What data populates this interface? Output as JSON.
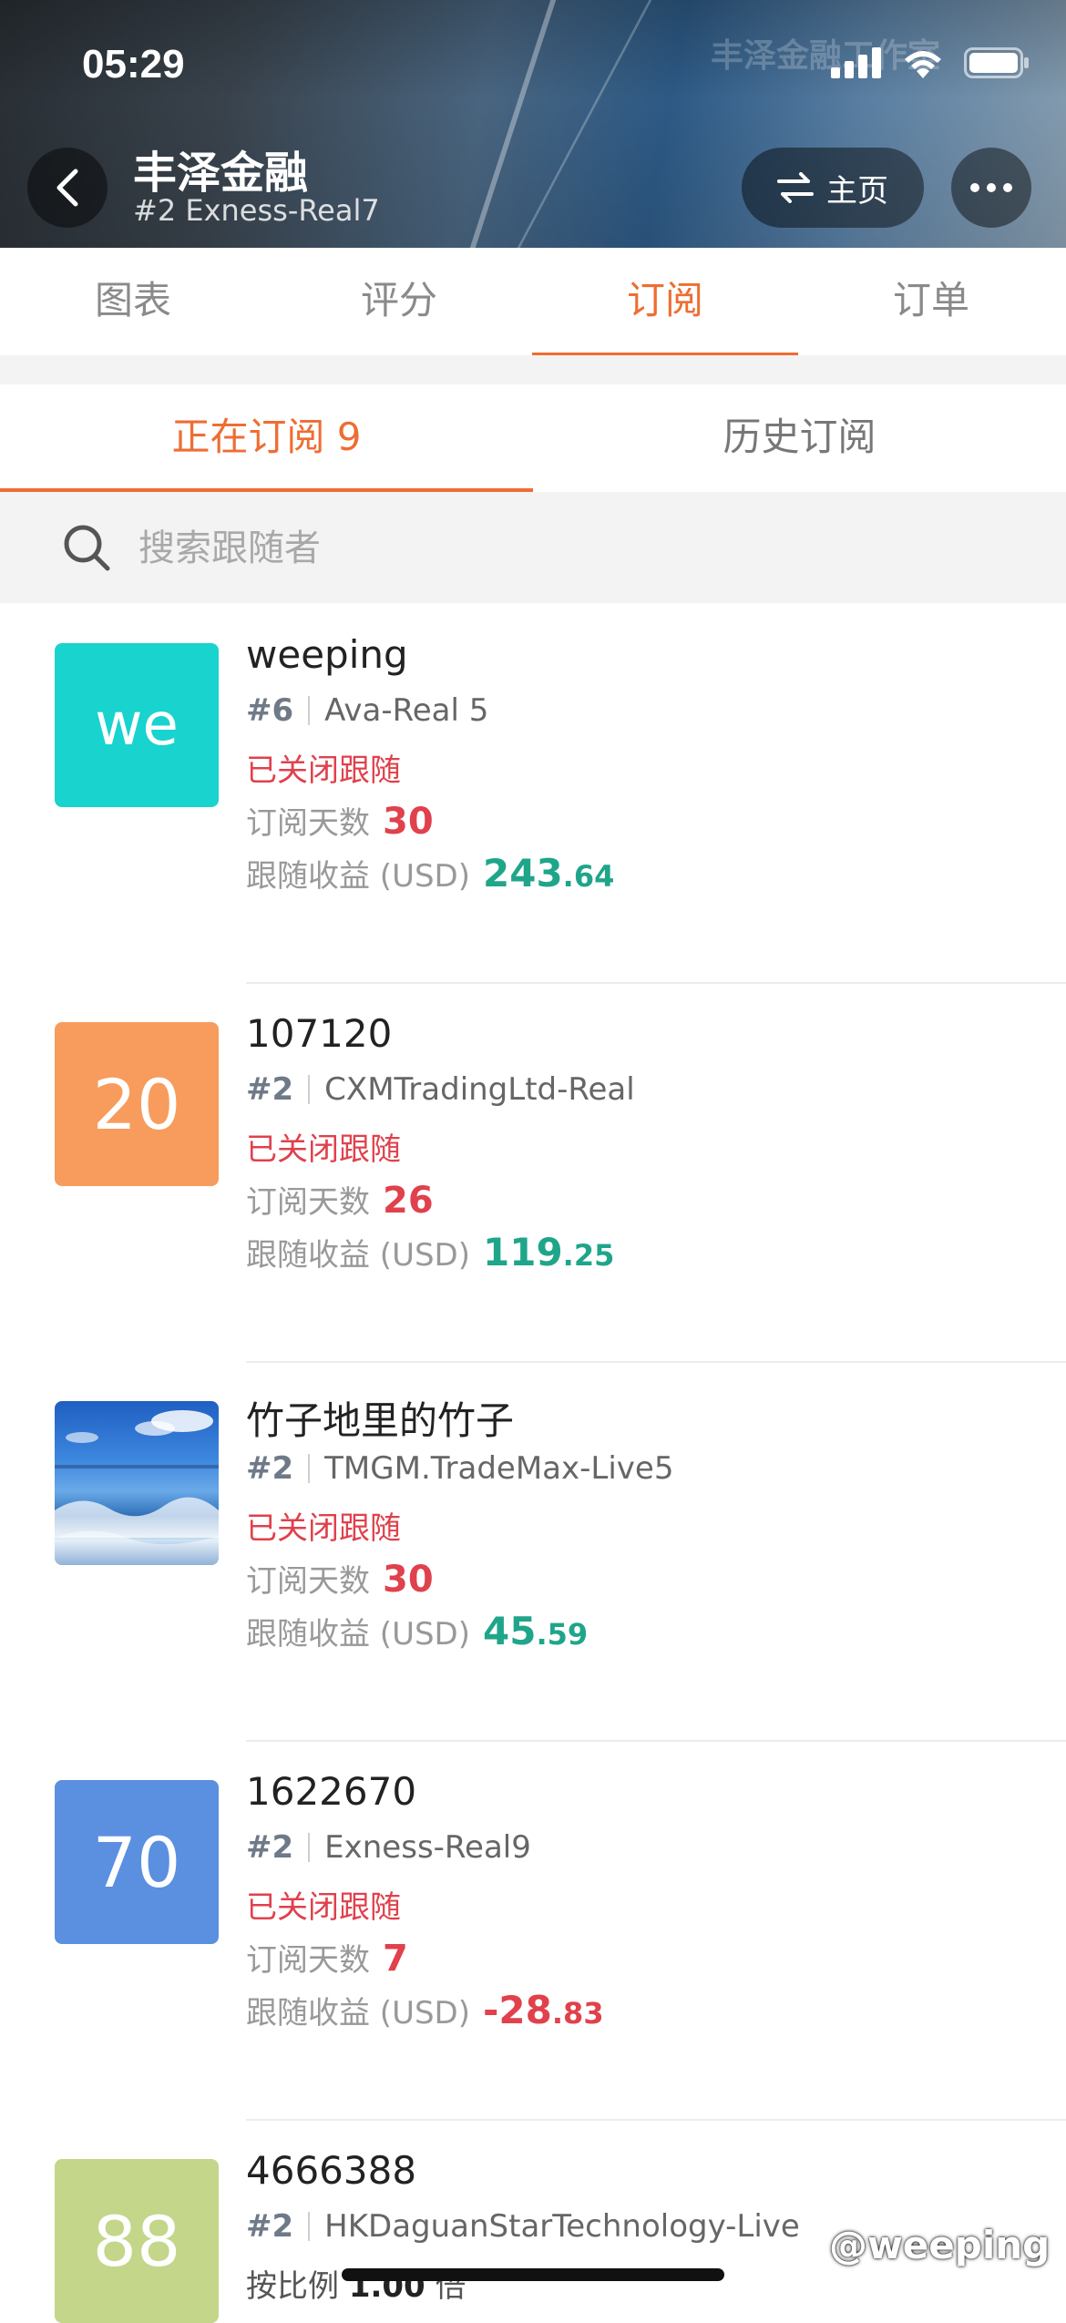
{
  "status_bar": {
    "time": "05:29"
  },
  "header": {
    "title": "丰泽金融",
    "subtitle": "#2 Exness-Real7",
    "home_label": "主页",
    "background_watermark": "丰泽金融工作室"
  },
  "top_tabs": [
    {
      "label": "图表",
      "active": false
    },
    {
      "label": "评分",
      "active": false
    },
    {
      "label": "订阅",
      "active": true
    },
    {
      "label": "订单",
      "active": false
    }
  ],
  "sub_tabs": [
    {
      "label": "正在订阅 9",
      "active": true
    },
    {
      "label": "历史订阅",
      "active": false
    }
  ],
  "search": {
    "placeholder": "搜索跟随者"
  },
  "labels": {
    "days": "订阅天数",
    "profit": "跟随收益 (USD)",
    "ratio_prefix": "按比例",
    "ratio_suffix": "倍"
  },
  "subscribers": [
    {
      "avatar_text": "we",
      "avatar_color": "#19d3cf",
      "name": "weeping",
      "rank": "#6",
      "server": "Ava-Real 5",
      "status": "已关闭跟随",
      "days": "30",
      "profit_int": "243",
      "profit_dec": ".64",
      "profit_sign": "positive"
    },
    {
      "avatar_text": "20",
      "avatar_color": "#f79c5d",
      "name": "107120",
      "rank": "#2",
      "server": "CXMTradingLtd-Real",
      "status": "已关闭跟随",
      "days": "26",
      "profit_int": "119",
      "profit_dec": ".25",
      "profit_sign": "positive"
    },
    {
      "avatar_text": "",
      "avatar_color": "#2f74c8",
      "name": "竹子地里的竹子",
      "rank": "#2",
      "server": "TMGM.TradeMax-Live5",
      "status": "已关闭跟随",
      "days": "30",
      "profit_int": "45",
      "profit_dec": ".59",
      "profit_sign": "positive"
    },
    {
      "avatar_text": "70",
      "avatar_color": "#5b8fe0",
      "name": "1622670",
      "rank": "#2",
      "server": "Exness-Real9",
      "status": "已关闭跟随",
      "days": "7",
      "profit_int": "-28",
      "profit_dec": ".83",
      "profit_sign": "negative"
    },
    {
      "avatar_text": "88",
      "avatar_color": "#c3d68a",
      "name": "4666388",
      "rank": "#2",
      "server": "HKDaguanStarTechnology-Live",
      "ratio_value": "1.00"
    }
  ],
  "watermark": "@weeping"
}
